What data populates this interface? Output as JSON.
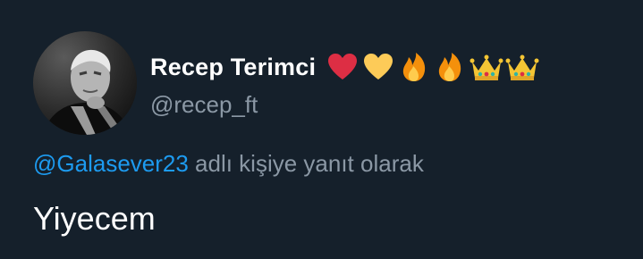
{
  "user": {
    "display_name": "Recep Terimci",
    "handle": "@recep_ft",
    "name_emojis": [
      "red-heart",
      "yellow-heart",
      "fire",
      "fire",
      "crown",
      "crown"
    ]
  },
  "reply": {
    "mention": "@Galasever23",
    "suffix": " adlı kişiye yanıt olarak"
  },
  "tweet": {
    "text": "Yiyecem"
  },
  "colors": {
    "background": "#15202b",
    "text_primary": "#ffffff",
    "text_secondary": "#8b98a5",
    "link": "#1d9bf0"
  }
}
